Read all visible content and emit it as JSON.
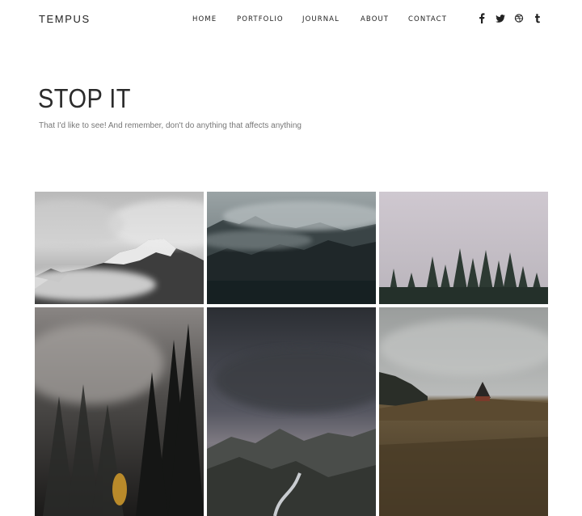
{
  "site": {
    "logo": "TEMPUS"
  },
  "nav": {
    "items": [
      {
        "label": "HOME"
      },
      {
        "label": "PORTFOLIO"
      },
      {
        "label": "JOURNAL"
      },
      {
        "label": "ABOUT"
      },
      {
        "label": "CONTACT"
      }
    ]
  },
  "social": {
    "icons": [
      "facebook-icon",
      "twitter-icon",
      "dribbble-icon",
      "tumblr-icon"
    ]
  },
  "hero": {
    "title": "STOP IT",
    "subtitle": "That I'd like to see! And remember, don't do anything that affects anything"
  },
  "gallery": {
    "photos": [
      {
        "subject": "misty snowy mountain peak"
      },
      {
        "subject": "foggy forested hillside"
      },
      {
        "subject": "pine treeline under pale sky"
      },
      {
        "subject": "dark misty forest with yellow tree"
      },
      {
        "subject": "stormy sky over valley with winding road"
      },
      {
        "subject": "grassy field with small A-frame hut"
      }
    ]
  },
  "colors": {
    "text": "#222222",
    "subtitle": "#777777",
    "background": "#ffffff"
  }
}
